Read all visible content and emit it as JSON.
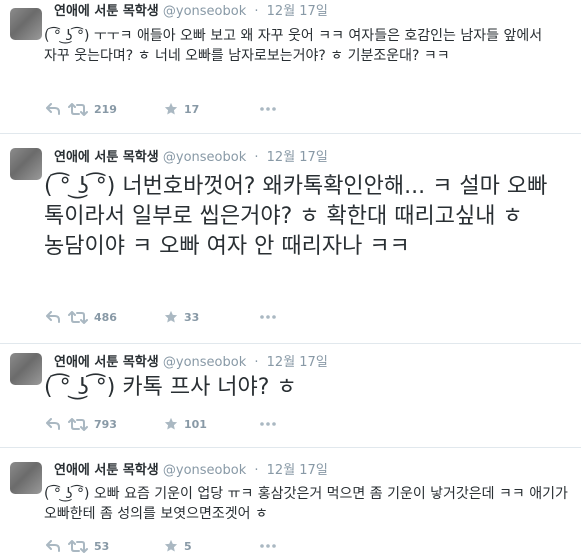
{
  "tweets": [
    {
      "name": "연애에 서툰 목학생",
      "handle": "@yonseobok",
      "time": "12월 17일",
      "text": "( ͡° ͜ʖ ͡°) ㅜㅜㅋ 애들아 오빠 보고 왜 자꾸 웃어 ㅋㅋ 여자들은 호감인는 남자들 앞에서 자꾸 웃는다며? ㅎ 너네 오빠를 남자로보는거야? ㅎ 기분조운대? ㅋㅋ",
      "retweets": "219",
      "favorites": "17"
    },
    {
      "name": "연애에 서툰 목학생",
      "handle": "@yonseobok",
      "time": "12월 17일",
      "text": "( ͡° ͜ʖ ͡°) 너번호바껏어? 왜카톡확인안해... ㅋ 설마 오빠 톡이라서 일부로 씹은거야? ㅎ 확한대 때리고싶내 ㅎ 농담이야 ㅋ 오빠 여자 안 때리자나 ㅋㅋ",
      "retweets": "486",
      "favorites": "33"
    },
    {
      "name": "연애에 서툰 목학생",
      "handle": "@yonseobok",
      "time": "12월 17일",
      "text": "( ͡° ͜ʖ ͡°) 카톡 프사 너야? ㅎ",
      "retweets": "793",
      "favorites": "101"
    },
    {
      "name": "연애에 서툰 목학생",
      "handle": "@yonseobok",
      "time": "12월 17일",
      "text": "( ͡° ͜ʖ ͡°) 오빠 요즘 기운이 업당 ㅠㅋ 홍삼갓은거 먹으면 좀 기운이 낳거갓은데 ㅋㅋ 애기가 오빠한테 좀 성의를 보엿으면조겟어 ㅎ",
      "retweets": "53",
      "favorites": "5"
    }
  ]
}
